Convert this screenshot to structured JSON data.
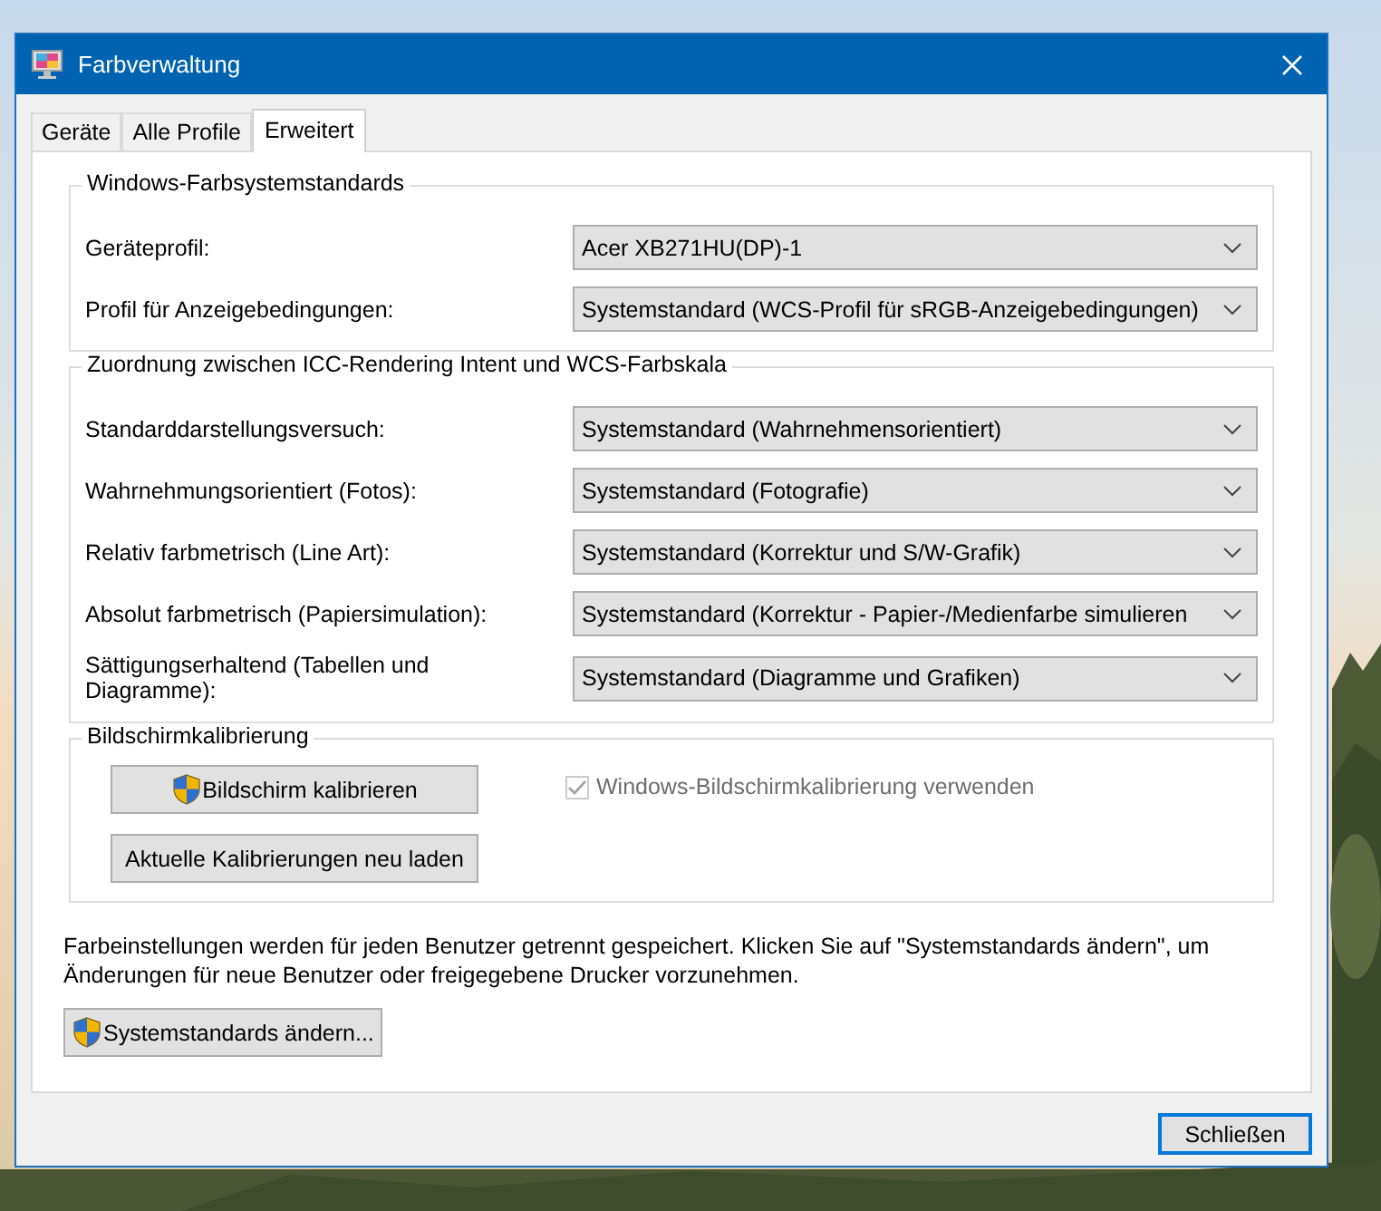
{
  "window": {
    "title": "Farbverwaltung"
  },
  "tabs": [
    {
      "label": "Geräte",
      "selected": false
    },
    {
      "label": "Alle Profile",
      "selected": false
    },
    {
      "label": "Erweitert",
      "selected": true
    }
  ],
  "groups": [
    {
      "title": "Windows-Farbsystemstandards",
      "rows": [
        {
          "label": "Geräteprofil:",
          "value": "Acer XB271HU(DP)-1"
        },
        {
          "label": "Profil für Anzeigebedingungen:",
          "value": "Systemstandard (WCS-Profil für sRGB-Anzeigebedingungen)"
        }
      ]
    },
    {
      "title": "Zuordnung zwischen ICC-Rendering Intent und WCS-Farbskala",
      "rows": [
        {
          "label": "Standarddarstellungsversuch:",
          "value": "Systemstandard (Wahrnehmensorientiert)"
        },
        {
          "label": "Wahrnehmungsorientiert (Fotos):",
          "value": "Systemstandard (Fotografie)"
        },
        {
          "label": "Relativ farbmetrisch (Line Art):",
          "value": "Systemstandard (Korrektur und S/W-Grafik)"
        },
        {
          "label": "Absolut farbmetrisch (Papiersimulation):",
          "value": "Systemstandard (Korrektur - Papier-/Medienfarbe simulieren"
        },
        {
          "label": "Sättigungserhaltend (Tabellen und Diagramme):",
          "value": "Systemstandard (Diagramme und Grafiken)"
        }
      ]
    }
  ],
  "calibration": {
    "title": "Bildschirmkalibrierung",
    "buttons": [
      {
        "label": "Bildschirm kalibrieren",
        "shield": true
      },
      {
        "label": "Aktuelle Kalibrierungen neu laden",
        "shield": false
      }
    ],
    "checkbox": {
      "label": "Windows-Bildschirmkalibrierung verwenden",
      "checked": true,
      "disabled": true
    }
  },
  "note": "Farbeinstellungen werden für jeden Benutzer getrennt gespeichert. Klicken Sie auf \"Systemstandards ändern\", um Änderungen für neue Benutzer oder freigegebene Drucker vorzunehmen.",
  "change_defaults_button": {
    "label": "Systemstandards ändern...",
    "shield": true
  },
  "close_button": {
    "label": "Schließen",
    "default": true
  }
}
